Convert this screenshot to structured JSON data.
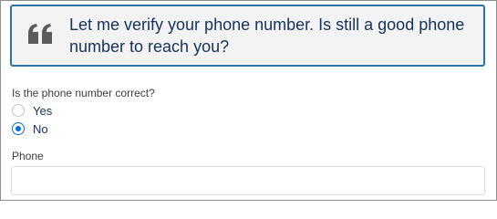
{
  "script": {
    "icon": "quote-icon",
    "text": "Let me verify your phone number. Is still a good phone number to reach you?"
  },
  "question": {
    "label": "Is the phone number correct?",
    "options": [
      {
        "label": "Yes",
        "checked": false
      },
      {
        "label": "No",
        "checked": true
      }
    ]
  },
  "phone": {
    "label": "Phone",
    "value": "",
    "placeholder": ""
  },
  "colors": {
    "accent": "#0070d2",
    "box_border": "#2b74a8",
    "box_background": "#f3f3f3",
    "quote_icon": "#5c5c5c"
  }
}
